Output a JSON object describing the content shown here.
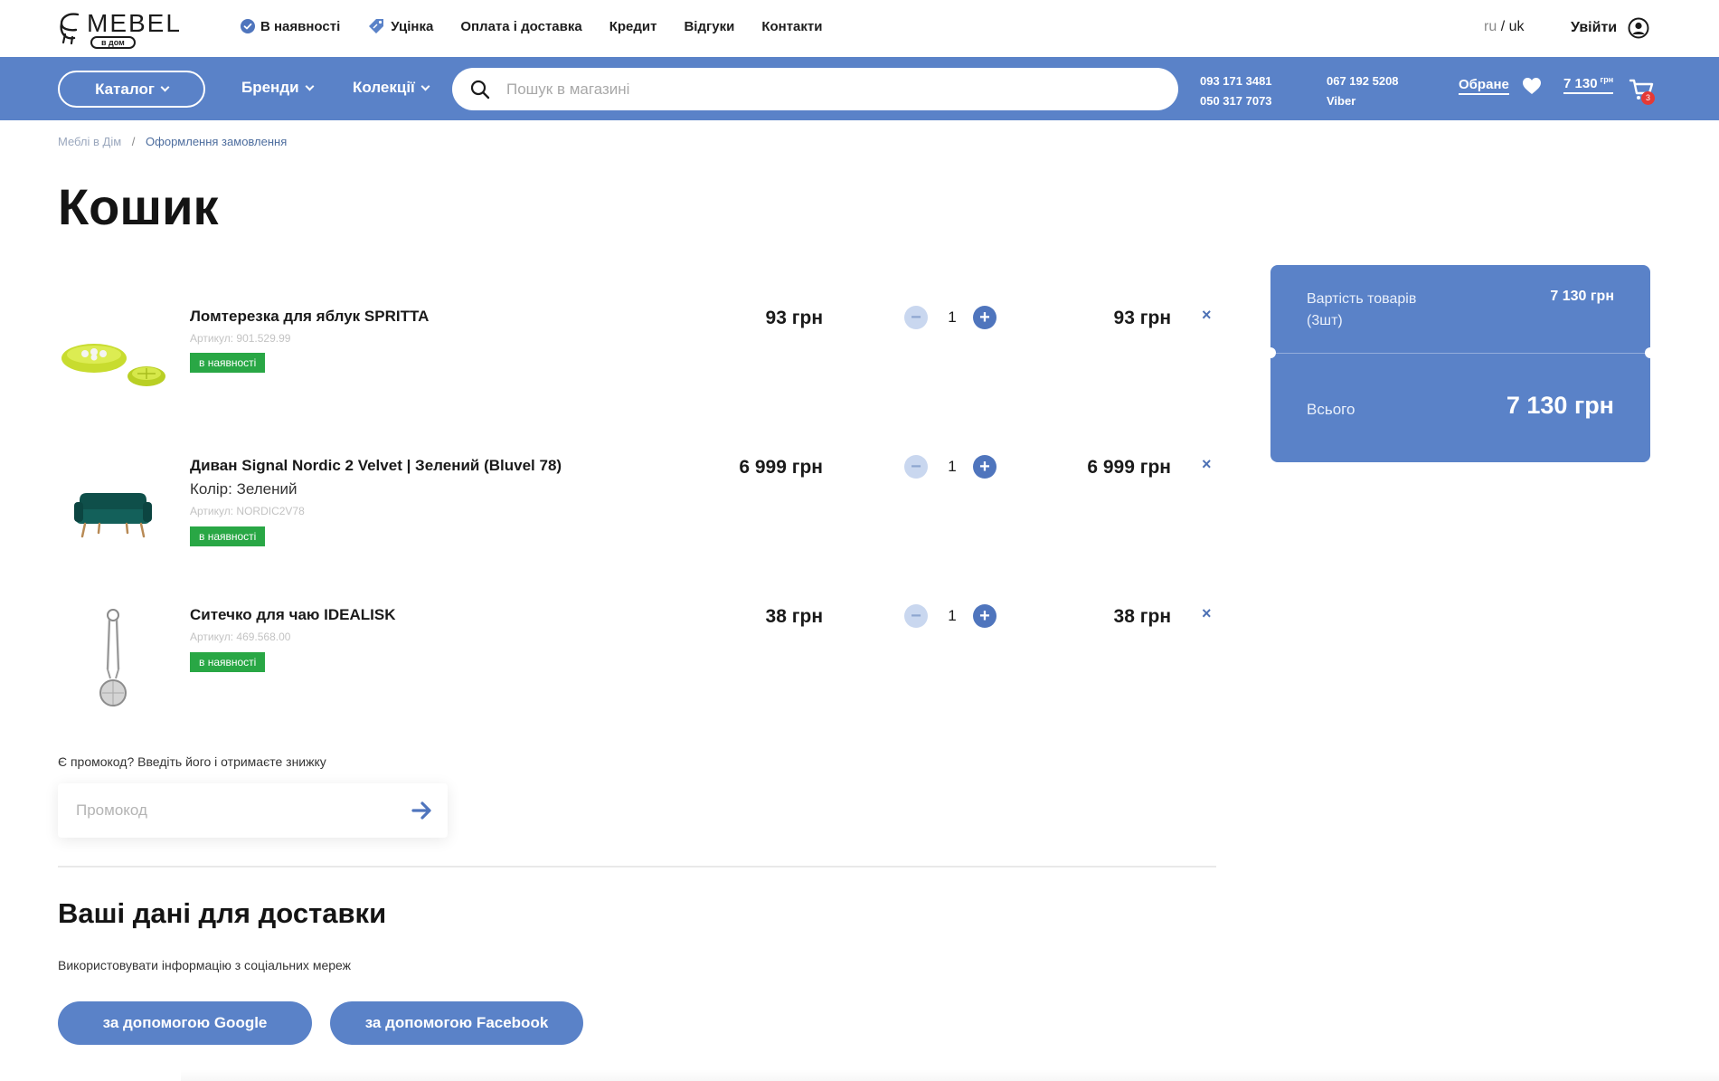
{
  "brand": {
    "name": "MEBEL",
    "tagline": "в дом"
  },
  "topnav": [
    {
      "label": "В наявності",
      "icon": "check-circle-icon"
    },
    {
      "label": "Уцінка",
      "icon": "discount-tag-icon"
    },
    {
      "label": "Оплата і доставка"
    },
    {
      "label": "Кредит"
    },
    {
      "label": "Відгуки"
    },
    {
      "label": "Контакти"
    }
  ],
  "lang": {
    "ru": "ru",
    "sep": "/",
    "uk": "uk",
    "active": "uk"
  },
  "login": {
    "label": "Увійти",
    "icon": "user-icon"
  },
  "header": {
    "catalog_label": "Каталог",
    "brands_label": "Бренди",
    "collections_label": "Колекції",
    "search_placeholder": "Пошук в магазині",
    "phones": {
      "col1_line1": "093 171 3481",
      "col1_line2": "050 317 7073",
      "col2_line1": "067 192 5208",
      "col2_line2": "Viber"
    },
    "favorites_label": "Обране",
    "cart_total": "7 130",
    "cart_currency": "грн",
    "cart_count": "3"
  },
  "breadcrumb": {
    "home": "Меблі в Дім",
    "sep": "/",
    "current": "Оформлення замовлення"
  },
  "page_title": "Кошик",
  "cart": {
    "items": [
      {
        "name": "Ломтерезка для яблук SPRITTA",
        "color": "",
        "sku": "Артикул: 901.529.99",
        "stock": "в наявності",
        "price": "93 грн",
        "qty": "1",
        "total": "93 грн",
        "minus": "−",
        "plus": "+",
        "remove": "×"
      },
      {
        "name": "Диван Signal Nordic 2 Velvet | Зелений (Bluvel 78)",
        "color": "Колір: Зелений",
        "sku": "Артикул: NORDIC2V78",
        "stock": "в наявності",
        "price": "6 999 грн",
        "qty": "1",
        "total": "6 999 грн",
        "minus": "−",
        "plus": "+",
        "remove": "×"
      },
      {
        "name": "Ситечко для чаю IDEALISK",
        "color": "",
        "sku": "Артикул: 469.568.00",
        "stock": "в наявності",
        "price": "38 грн",
        "qty": "1",
        "total": "38 грн",
        "minus": "−",
        "plus": "+",
        "remove": "×"
      }
    ]
  },
  "summary": {
    "goods_label": "Вартість товарів (3шт)",
    "goods_value": "7 130 грн",
    "total_label": "Всього",
    "total_value": "7 130 грн"
  },
  "promo": {
    "hint": "Є промокод? Введіть його і отримаєте знижку",
    "placeholder": "Промокод"
  },
  "delivery": {
    "title": "Ваші дані для доставки",
    "social_hint": "Використовувати інформацію з соціальних мереж",
    "google_label": "за допомогою Google",
    "facebook_label": "за допомогою Facebook"
  },
  "colors": {
    "accent": "#5a82c8",
    "accent_dark": "#4f75bd",
    "stock_green": "#29a745",
    "badge_red": "#e53935"
  }
}
